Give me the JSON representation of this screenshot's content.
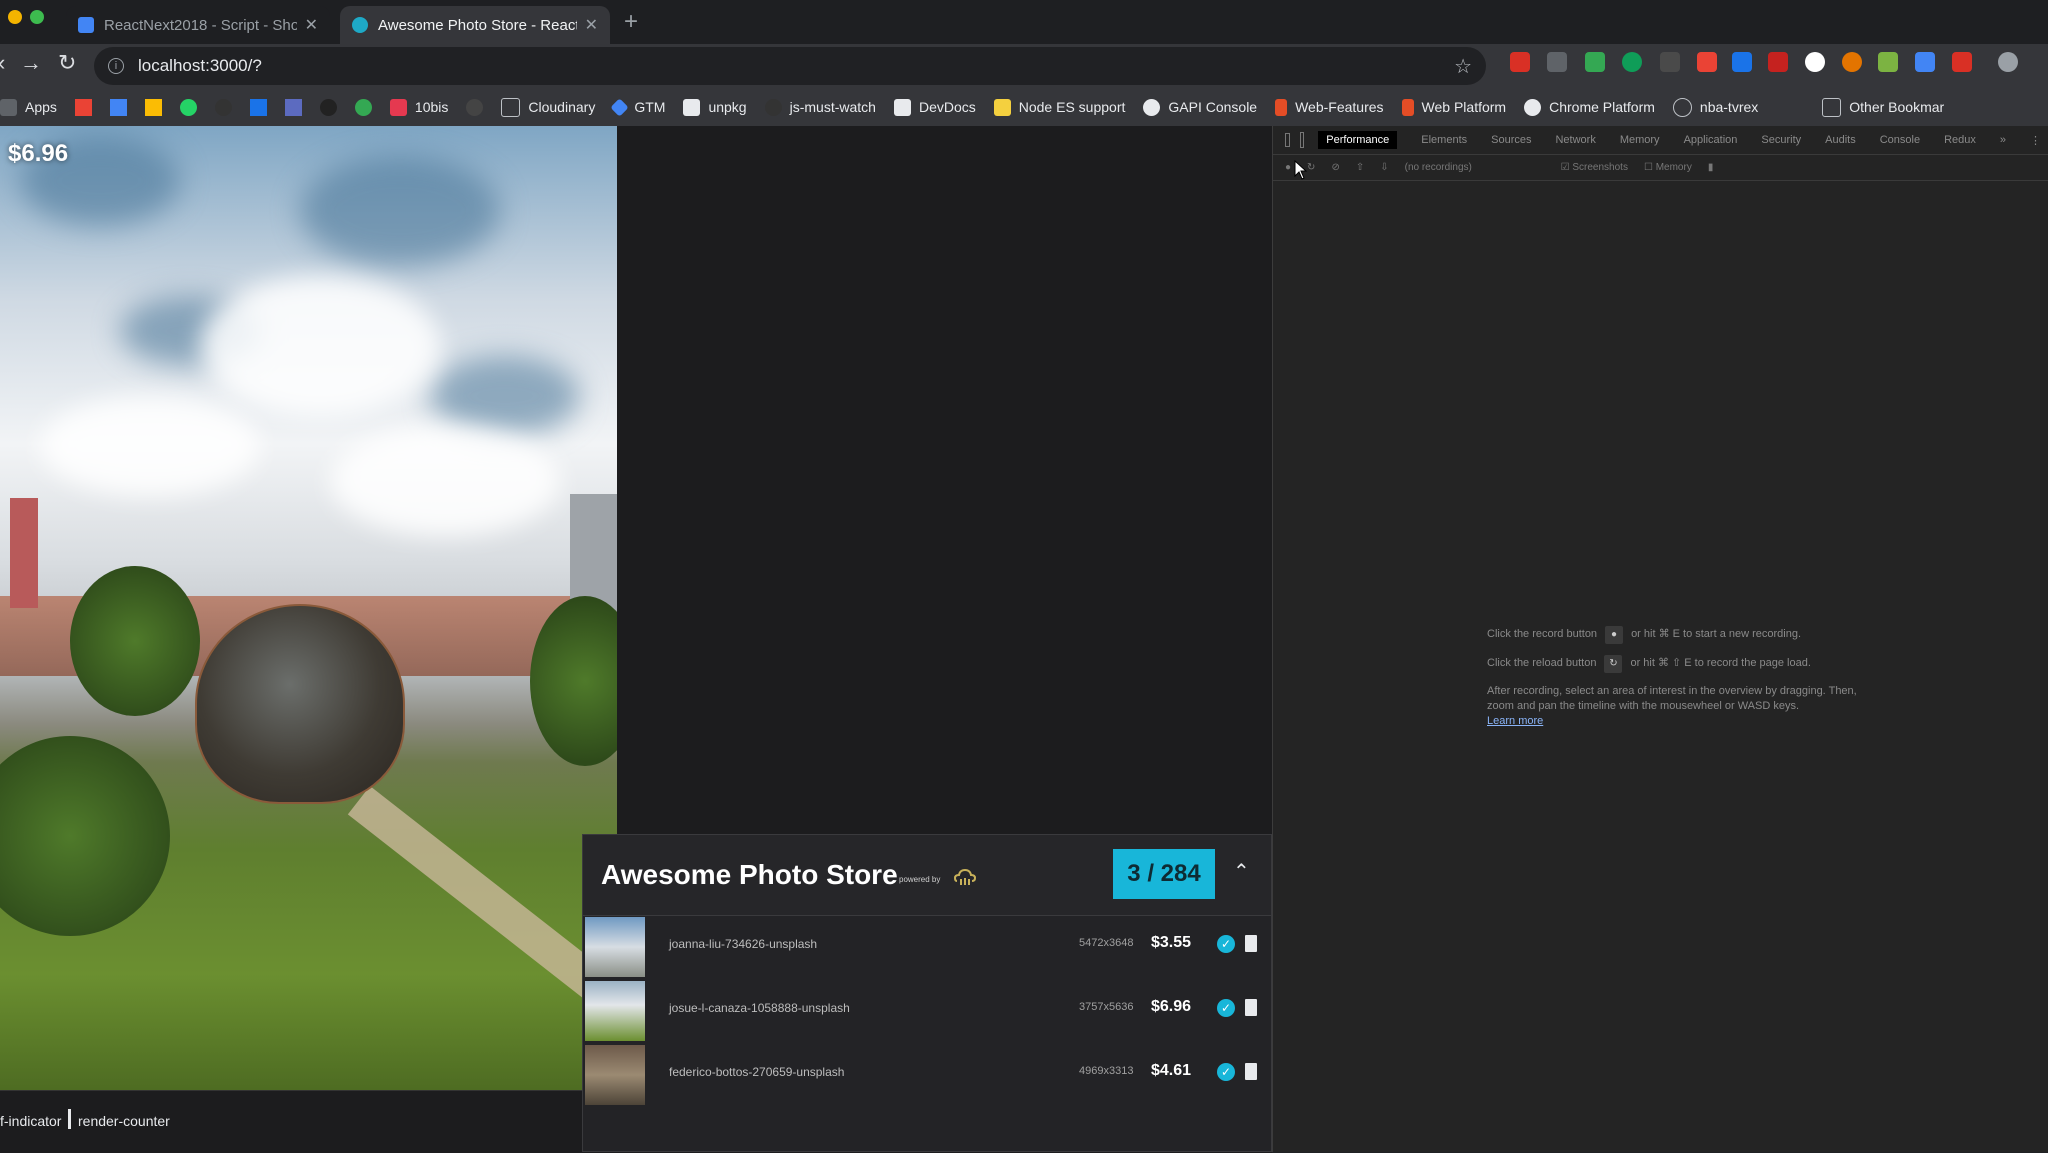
{
  "browser": {
    "tabs": [
      {
        "title": "ReactNext2018 - Script - Sho"
      },
      {
        "title": "Awesome Photo Store - React"
      }
    ],
    "url": "localhost:3000/?",
    "bookmarks": [
      "Apps",
      "10bis",
      "Cloudinary",
      "GTM",
      "unpkg",
      "js-must-watch",
      "DevDocs",
      "Node ES support",
      "GAPI Console",
      "Web-Features",
      "Web Platform",
      "Chrome Platform",
      "nba-tvrex",
      "Other Bookmar"
    ]
  },
  "page": {
    "photo_price": "$6.96",
    "status_items": [
      "f-indicator",
      "render-counter"
    ],
    "cart": {
      "title": "Awesome Photo Store",
      "powered_by": "powered by",
      "count": "3 / 284",
      "items": [
        {
          "name": "joanna-liu-734626-unsplash",
          "dims": "5472x3648",
          "price": "$3.55"
        },
        {
          "name": "josue-l-canaza-1058888-unsplash",
          "dims": "3757x5636",
          "price": "$6.96"
        },
        {
          "name": "federico-bottos-270659-unsplash",
          "dims": "4969x3313",
          "price": "$4.61"
        }
      ]
    }
  },
  "devtools": {
    "tabs": [
      "Performance",
      "Elements",
      "Sources",
      "Network",
      "Memory",
      "Application",
      "Security",
      "Audits",
      "Console",
      "Redux",
      "»"
    ],
    "toolbar": [
      "(no recordings)",
      "Screenshots",
      "Memory"
    ],
    "hints": [
      "Click the record button",
      "or hit ⌘ E to start a new recording.",
      "Click the reload button",
      "or hit ⌘ ⇧ E to record the page load.",
      "After recording, select an area of interest in the overview by dragging. Then, zoom and pan the timeline with the mousewheel or WASD keys.",
      "Learn more"
    ]
  },
  "colors": {
    "accent": "#18b6d9",
    "devtools_bg": "#242424",
    "page_bg": "#1c1c1e"
  }
}
